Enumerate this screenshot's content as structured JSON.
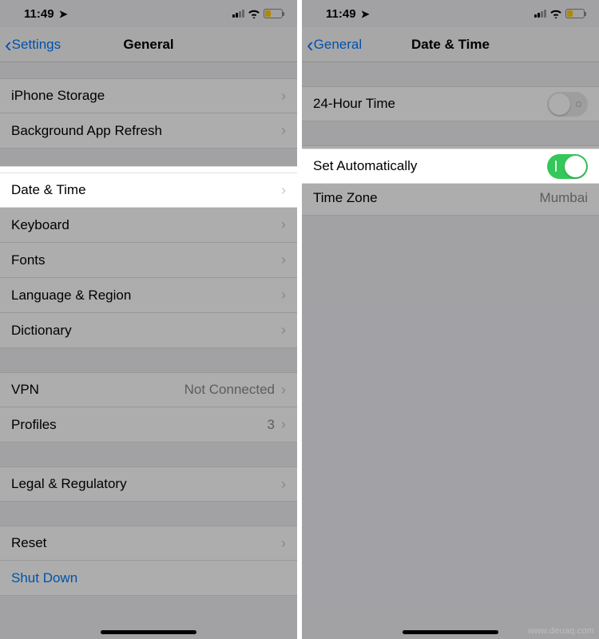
{
  "status": {
    "time": "11:49",
    "location_indicator": "➤"
  },
  "left": {
    "back_label": "Settings",
    "title": "General",
    "rows": {
      "iphone_storage": "iPhone Storage",
      "bg_app_refresh": "Background App Refresh",
      "date_time": "Date & Time",
      "keyboard": "Keyboard",
      "fonts": "Fonts",
      "lang_region": "Language & Region",
      "dictionary": "Dictionary",
      "vpn": "VPN",
      "vpn_value": "Not Connected",
      "profiles": "Profiles",
      "profiles_value": "3",
      "legal": "Legal & Regulatory",
      "reset": "Reset",
      "shutdown": "Shut Down"
    }
  },
  "right": {
    "back_label": "General",
    "title": "Date & Time",
    "rows": {
      "twentyfour": "24-Hour Time",
      "set_auto": "Set Automatically",
      "time_zone": "Time Zone",
      "time_zone_value": "Mumbai"
    },
    "twentyfour_on": false,
    "set_auto_on": true
  },
  "watermark": "www.deuaq.com"
}
